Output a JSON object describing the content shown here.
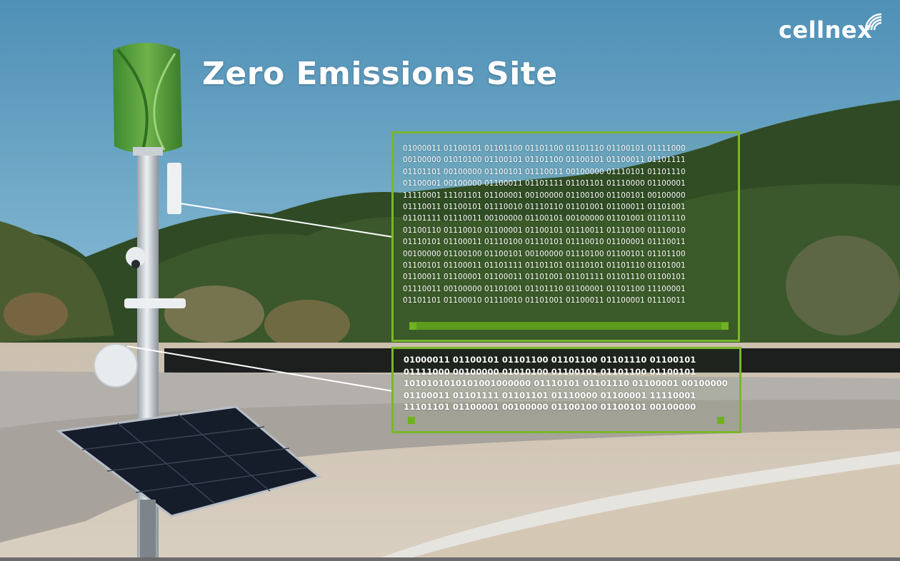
{
  "title": "Zero Emissions Site",
  "brand": {
    "name": "cellnex",
    "icon": "signal-waves-icon"
  },
  "colors": {
    "accent": "#7ab62b",
    "sky": "#5e9ec3"
  },
  "binary_top": [
    "01000011 01100101 01101100 01101100 01101110 01100101 01111000",
    "00100000 01010100 01100101 01101100 01100101 01100011 01101111",
    "01101101 00100000 01100101 01110011 00100000 01110101 01101110",
    "01100001 00100000 01100011 01101111 01101101 01110000 01100001",
    "11110001 11101101 01100001 00100000 01100100 01100101 00100000",
    "01110011 01100101 01110010 01110110 01101001 01100011 01101001",
    "01101111 01110011 00100000 01100101 00100000 01101001 01101110",
    "01100110 01110010 01100001 01100101 01110011 01110100 01110010",
    "01110101 01100011 01110100 01110101 01110010 01100001 01110011",
    "00100000 01100100 01100101 00100000 01110100 01100101 01101100",
    "01100101 01100011 01101111 01101101 01110101 01101110 01101001",
    "01100011 01100001 01100011 01101001 01101111 01101110 01100101",
    "01110011 00100000 01101001 01101110 01100001 01101100 11100001",
    "01101101 01100010 01110010 01101001 01100011 01100001 01110011"
  ],
  "binary_bottom": [
    "01000011 01100101 01101100 01101100 01101110 01100101",
    "01111000 00100000 01010100 01100101 01101100 01100101",
    "1010101010101001000000 01110101 01101110 01100001 00100000",
    "01100011 01101111 01101101 01110000 01100001 11110001",
    "11101101 01100001 00100000 01100100 01100101 00100000"
  ]
}
